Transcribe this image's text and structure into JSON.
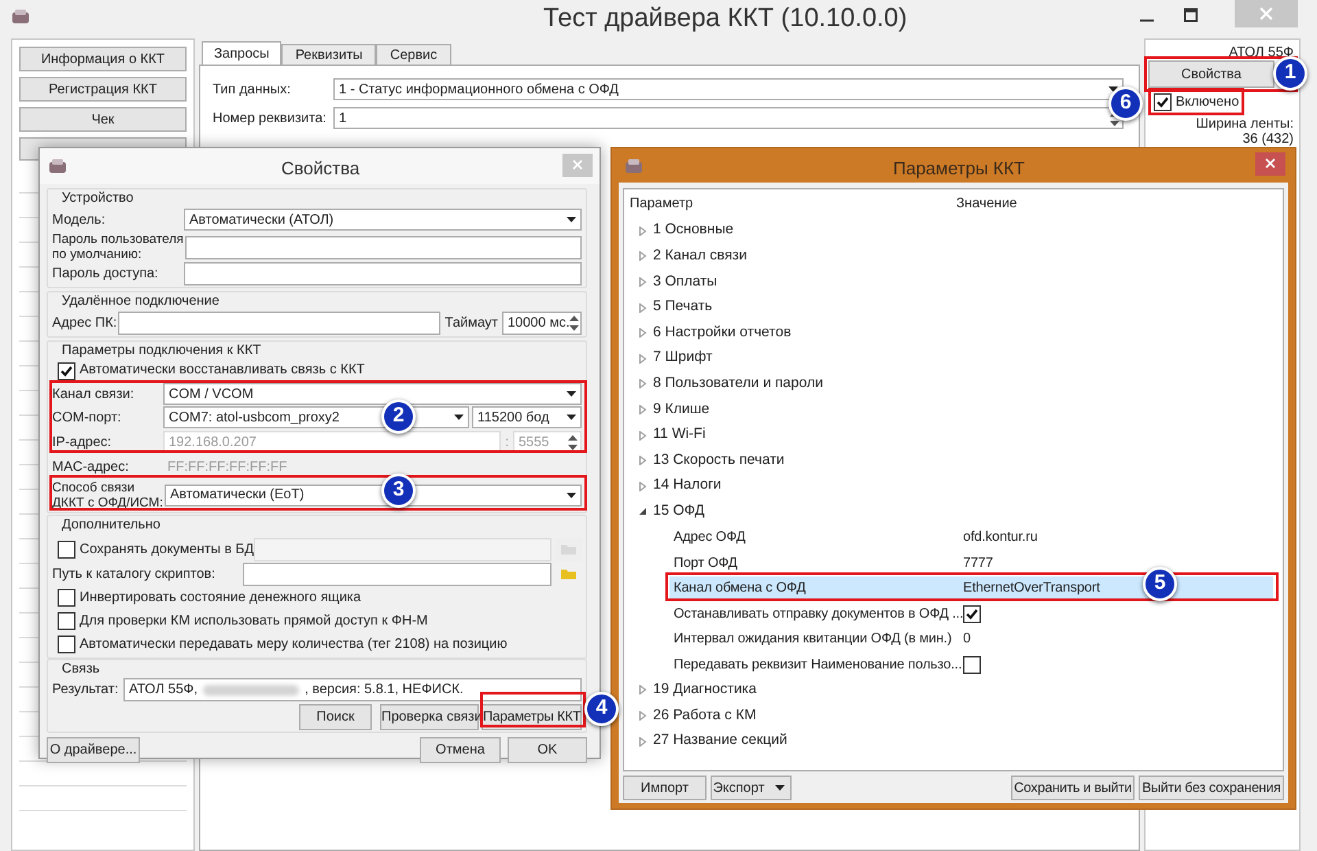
{
  "main_window": {
    "title": "Тест драйвера ККТ (10.10.0.0)",
    "nav_buttons": [
      "Информация о ККТ",
      "Регистрация ККТ",
      "Чек"
    ],
    "tabs": [
      {
        "label": "Запросы",
        "selected": true
      },
      {
        "label": "Реквизиты",
        "selected": false
      },
      {
        "label": "Сервис",
        "selected": false
      }
    ],
    "fields": [
      {
        "label": "Тип данных:",
        "value": "1 - Статус информационного обмена с ОФД",
        "kind": "dropdown"
      },
      {
        "label": "Номер реквизита:",
        "value": "1",
        "kind": "spin"
      }
    ],
    "device": {
      "model": "АТОЛ 55Ф",
      "properties_button": "Свойства",
      "enabled": {
        "label": "Включено",
        "checked": true
      },
      "tape_width_label": "Ширина ленты:",
      "tape_width_value": "36 (432)"
    }
  },
  "properties_dialog": {
    "title": "Свойства",
    "device_group": {
      "legend": "Устройство",
      "model_label": "Модель:",
      "model_value": "Автоматически (АТОЛ)",
      "user_password_label": "Пароль пользователя по умолчанию:",
      "access_password_label": "Пароль доступа:"
    },
    "remote_group": {
      "legend": "Удалённое подключение",
      "address_label": "Адрес ПК:",
      "timeout_label": "Таймаут",
      "timeout_value": "10000 мс."
    },
    "connection_group": {
      "legend": "Параметры подключения к ККТ",
      "auto_reconnect": {
        "label": "Автоматически восстанавливать связь с ККТ",
        "checked": true
      },
      "channel_label": "Канал связи:",
      "channel_value": "COM / VCOM",
      "port_label": "COM-порт:",
      "port_value": "COM7: atol-usbcom_proxy2",
      "baud_value": "115200 бод",
      "ip": {
        "label": "IP-адрес:",
        "value": "192.168.0.207",
        "separator": ":",
        "port": "5555",
        "disabled": true
      },
      "mac_label": "MAC-адрес:",
      "mac_value": "FF:FF:FF:FF:FF:FF",
      "ofd_label": "Способ связи ДККТ с ОФД/ИСМ:",
      "ofd_value": "Автоматически (EoT)"
    },
    "extra_group": {
      "legend": "Дополнительно",
      "save_docs": {
        "label": "Сохранять документы в БД",
        "checked": false
      },
      "scripts_label": "Путь к каталогу скриптов:",
      "options": [
        {
          "label": "Инвертировать состояние денежного ящика",
          "checked": false
        },
        {
          "label": "Для проверки КМ использовать прямой доступ к ФН-М",
          "checked": false
        },
        {
          "label": "Автоматически передавать меру количества (тег 2108) на позицию",
          "checked": false
        }
      ]
    },
    "link_group": {
      "legend": "Связь",
      "result_label": "Результат:",
      "result_before": "АТОЛ 55Ф,",
      "result_after": ", версия: 5.8.1, НЕФИСК."
    },
    "search_button": "Поиск",
    "check_button": "Проверка связи",
    "params_button": "Параметры ККТ",
    "about_button": "О драйвере...",
    "cancel_button": "Отмена",
    "ok_button": "OK"
  },
  "params_dialog": {
    "title": "Параметры ККТ",
    "columns": [
      "Параметр",
      "Значение"
    ],
    "tree": [
      {
        "label": "1 Основные",
        "expanded": false,
        "selected": false
      },
      {
        "label": "2 Канал связи",
        "expanded": false,
        "selected": false
      },
      {
        "label": "3 Оплаты",
        "expanded": false,
        "selected": false
      },
      {
        "label": "5 Печать",
        "expanded": false,
        "selected": false
      },
      {
        "label": "6 Настройки отчетов",
        "expanded": false,
        "selected": false
      },
      {
        "label": "7 Шрифт",
        "expanded": false,
        "selected": false
      },
      {
        "label": "8 Пользователи и пароли",
        "expanded": false,
        "selected": false
      },
      {
        "label": "9 Клише",
        "expanded": false,
        "selected": false
      },
      {
        "label": "11 Wi-Fi",
        "expanded": false,
        "selected": false
      },
      {
        "label": "13 Скорость печати",
        "expanded": false,
        "selected": false
      },
      {
        "label": "14 Налоги",
        "expanded": false,
        "selected": false
      },
      {
        "label": "15 ОФД",
        "expanded": true,
        "selected": false,
        "children": [
          {
            "label": "Адрес ОФД",
            "kind": "text",
            "value": "ofd.kontur.ru",
            "selected": false
          },
          {
            "label": "Порт ОФД",
            "kind": "text",
            "value": "7777",
            "selected": false
          },
          {
            "label": "Канал обмена с ОФД",
            "kind": "text",
            "value": "EthernetOverTransport",
            "selected": true
          },
          {
            "label": "Останавливать отправку документов в ОФД ...",
            "kind": "checkbox",
            "checked": true,
            "selected": false
          },
          {
            "label": "Интервал ожидания квитанции ОФД (в мин.)",
            "kind": "text",
            "value": "0",
            "selected": false
          },
          {
            "label": "Передавать реквизит Наименование пользо...",
            "kind": "checkbox",
            "checked": false,
            "selected": false
          }
        ]
      },
      {
        "label": "19 Диагностика",
        "expanded": false,
        "selected": false
      },
      {
        "label": "26 Работа с КМ",
        "expanded": false,
        "selected": false
      },
      {
        "label": "27 Название секций",
        "expanded": false,
        "selected": false
      }
    ],
    "import_button": "Импорт",
    "export_button": "Экспорт",
    "save_button": "Сохранить и выйти",
    "exit_button": "Выйти без сохранения"
  },
  "callouts": [
    "1",
    "2",
    "3",
    "4",
    "5",
    "6"
  ]
}
